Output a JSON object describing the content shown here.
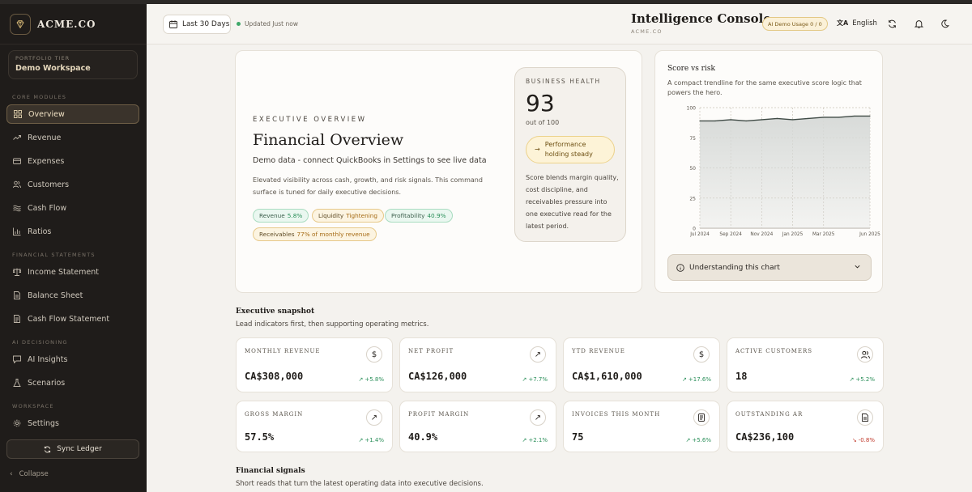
{
  "sidebar": {
    "brand": "ACME.CO",
    "tier_label": "PORTFOLIO TIER",
    "tier_value": "Demo Workspace",
    "sections": {
      "core": "CORE MODULES",
      "statements": "FINANCIAL STATEMENTS",
      "ai": "AI DECISIONING",
      "workspace": "WORKSPACE"
    },
    "items": {
      "overview": "Overview",
      "revenue": "Revenue",
      "expenses": "Expenses",
      "customers": "Customers",
      "cashflow": "Cash Flow",
      "ratios": "Ratios",
      "income": "Income Statement",
      "balance": "Balance Sheet",
      "cfstatement": "Cash Flow Statement",
      "insights": "AI Insights",
      "scenarios": "Scenarios",
      "settings": "Settings"
    },
    "active_item": "Overview",
    "sync_label": "Sync Ledger",
    "collapse_label": "Collapse"
  },
  "header": {
    "date_range": "Last 30 Days",
    "updated": "Updated Just now",
    "title": "Intelligence Console",
    "subtitle": "ACME.CO",
    "usage": "AI Demo Usage 0 / 0",
    "language": "English",
    "icons": [
      "refresh-icon",
      "bell-icon",
      "moon-icon"
    ]
  },
  "hero": {
    "eyebrow": "EXECUTIVE OVERVIEW",
    "title": "Financial Overview",
    "subtitle": "Demo data - connect QuickBooks in Settings to see live data",
    "description": "Elevated visibility across cash, growth, and risk signals. This command surface is tuned for daily executive decisions.",
    "chips": {
      "revenue_label": "Revenue",
      "revenue_value": "5.8%",
      "liquidity_label": "Liquidity",
      "liquidity_value": "Tightening",
      "profit_label": "Profitability",
      "profit_value": "40.9%",
      "recv_label": "Receivables",
      "recv_value": "77% of monthly revenue"
    },
    "health": {
      "label": "BUSINESS HEALTH",
      "score": "93",
      "out_of": "out of 100",
      "status": "Performance holding steady",
      "description": "Score blends margin quality, cost discipline, and receivables pressure into one executive read for the latest period."
    }
  },
  "score_chart": {
    "title": "Score vs risk",
    "description": "A compact trendline for the same executive score logic that powers the hero.",
    "understand_label": "Understanding this chart"
  },
  "chart_data": {
    "type": "area",
    "title": "Score vs risk",
    "x": [
      "Jul 2024",
      "Aug 2024",
      "Sep 2024",
      "Oct 2024",
      "Nov 2024",
      "Dec 2024",
      "Jan 2025",
      "Feb 2025",
      "Mar 2025",
      "Apr 2025",
      "May 2025",
      "Jun 2025"
    ],
    "series": [
      {
        "values": [
          89,
          89,
          90,
          89,
          90,
          91,
          90,
          91,
          92,
          92,
          93,
          93
        ]
      }
    ],
    "x_ticks": [
      "Jul 2024",
      "Sep 2024",
      "Nov 2024",
      "Jan 2025",
      "Mar 2025",
      "Jun 2025"
    ],
    "y_ticks": [
      "0",
      "25",
      "50",
      "75",
      "100"
    ],
    "ylim": [
      0,
      100
    ],
    "grid": true,
    "colors": {
      "line": "#3f4a45",
      "fill": "#d6d9d7"
    }
  },
  "snapshot": {
    "title": "Executive snapshot",
    "subtitle": "Lead indicators first, then supporting operating metrics.",
    "kpis": [
      {
        "label": "MONTHLY REVENUE",
        "value": "CA$308,000",
        "delta": "+5.8%",
        "trend": "up",
        "icon": "dollar-icon",
        "glyph": "$"
      },
      {
        "label": "NET PROFIT",
        "value": "CA$126,000",
        "delta": "+7.7%",
        "trend": "up",
        "icon": "trend-up-icon",
        "glyph": "↗"
      },
      {
        "label": "YTD REVENUE",
        "value": "CA$1,610,000",
        "delta": "+17.6%",
        "trend": "up",
        "icon": "dollar-icon",
        "glyph": "$"
      },
      {
        "label": "ACTIVE CUSTOMERS",
        "value": "18",
        "delta": "+5.2%",
        "trend": "up",
        "icon": "users-icon",
        "glyph": ""
      },
      {
        "label": "GROSS MARGIN",
        "value": "57.5%",
        "delta": "+1.4%",
        "trend": "up",
        "icon": "trend-up-icon",
        "glyph": "↗"
      },
      {
        "label": "PROFIT MARGIN",
        "value": "40.9%",
        "delta": "+2.1%",
        "trend": "up",
        "icon": "trend-up-icon",
        "glyph": "↗"
      },
      {
        "label": "INVOICES THIS MONTH",
        "value": "75",
        "delta": "+5.6%",
        "trend": "up",
        "icon": "invoice-icon",
        "glyph": ""
      },
      {
        "label": "OUTSTANDING AR",
        "value": "CA$236,100",
        "delta": "-0.8%",
        "trend": "down",
        "icon": "document-icon",
        "glyph": ""
      }
    ]
  },
  "signals": {
    "title": "Financial signals",
    "subtitle": "Short reads that turn the latest operating data into executive decisions."
  }
}
